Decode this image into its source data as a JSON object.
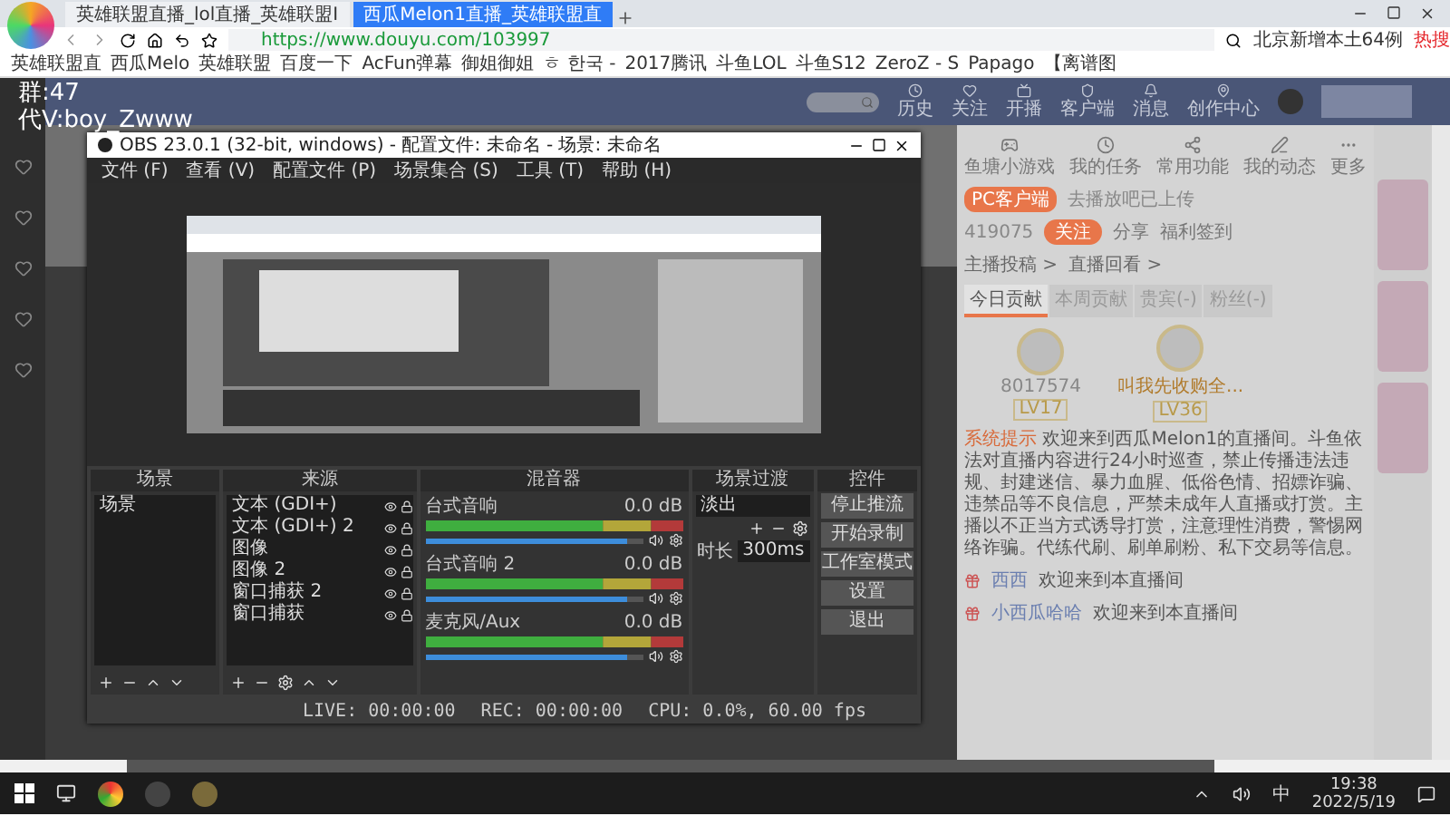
{
  "browser": {
    "tabs": [
      {
        "title": "英雄联盟直播_lol直播_英雄联盟I",
        "selected": false
      },
      {
        "title": "西瓜Melon1直播_英雄联盟直",
        "selected": true
      }
    ],
    "url": "https://www.douyu.com/103997",
    "search_hint": "北京新增本土64例",
    "hot_label": "热搜",
    "bookmarks": [
      "英雄联盟直",
      "西瓜Melo",
      "英雄联盟",
      "百度一下",
      "AcFun弹幕",
      "御姐御姐",
      "ㅎ 한국 -",
      "2017腾讯",
      "斗鱼LOL",
      "斗鱼S12",
      "ZeroZ - S",
      "Papago",
      "【离谱图"
    ]
  },
  "overlay_text": [
    "群:47",
    "代V:boy_Zwww"
  ],
  "douyu": {
    "header_links": [
      "历史",
      "关注",
      "开播",
      "客户端",
      "消息",
      "创作中心"
    ],
    "tools": [
      "鱼塘小游戏",
      "我的任务",
      "常用功能",
      "我的动态",
      "更多"
    ],
    "pc_client": "PC客户端",
    "pc_client_note": "去播放吧已上传",
    "follow_count": "419075",
    "follow_button": "关注",
    "share": "分享",
    "report": "福利签到",
    "rank_links": [
      "主播投稿 >",
      "直播回看 >"
    ],
    "rank_tabs": [
      {
        "label": "今日贡献",
        "selected": true
      },
      {
        "label": "本周贡献",
        "selected": false
      },
      {
        "label": "贵宾(-)",
        "selected": false
      },
      {
        "label": "粉丝(-)",
        "selected": false
      }
    ],
    "fans": [
      {
        "name": "8017574",
        "badge": "LV17"
      },
      {
        "name": "叫我先收购全...",
        "badge": "LV36"
      }
    ],
    "chat": {
      "notice_label": "系统提示",
      "notice": "欢迎来到西瓜Melon1的直播间。斗鱼依法对直播内容进行24小时巡查，禁止传播违法违规、封建迷信、暴力血腥、低俗色情、招嫖诈骗、违禁品等不良信息，严禁未成年人直播或打赏。主播以不正当方式诱导打赏，注意理性消费，警惕网络诈骗。代练代刷、刷单刷粉、私下交易等信息。",
      "messages": [
        {
          "name": "西西",
          "text": "欢迎来到本直播间"
        },
        {
          "name": "小西瓜哈哈",
          "text": "欢迎来到本直播间"
        }
      ]
    }
  },
  "obs": {
    "title": "OBS 23.0.1 (32-bit, windows) - 配置文件: 未命名 - 场景: 未命名",
    "menu": [
      "文件 (F)",
      "查看 (V)",
      "配置文件 (P)",
      "场景集合 (S)",
      "工具 (T)",
      "帮助 (H)"
    ],
    "scenes": {
      "title": "场景",
      "items": [
        "场景"
      ]
    },
    "sources": {
      "title": "来源",
      "items": [
        "文本 (GDI+)",
        "文本 (GDI+) 2",
        "图像",
        "图像 2",
        "窗口捕获 2",
        "窗口捕获"
      ]
    },
    "mixer": {
      "title": "混音器",
      "channels": [
        {
          "name": "台式音响",
          "reading": "0.0 dB",
          "level": 0.93
        },
        {
          "name": "台式音响 2",
          "reading": "0.0 dB",
          "level": 0.93
        },
        {
          "name": "麦克风/Aux",
          "reading": "0.0 dB",
          "level": 0.93
        }
      ]
    },
    "transitions": {
      "title": "场景过渡",
      "type": "淡出",
      "duration_label": "时长",
      "duration": "300ms"
    },
    "controls": {
      "title": "控件",
      "buttons": [
        "停止推流",
        "开始录制",
        "工作室模式",
        "设置",
        "退出"
      ]
    },
    "status": [
      "LIVE: 00:00:00",
      "REC: 00:00:00",
      "CPU: 0.0%, 60.00 fps"
    ]
  },
  "taskbar": {
    "ime": "中",
    "time": "19:38",
    "date": "2022/5/19"
  }
}
